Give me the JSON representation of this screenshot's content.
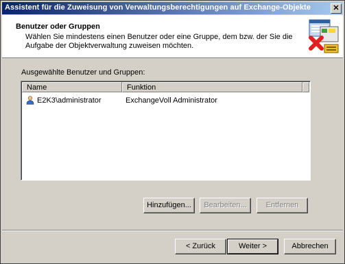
{
  "window": {
    "title": "Assistent für die Zuweisung von Verwaltungsberechtigungen auf Exchange-Objekte",
    "close_glyph": "✕"
  },
  "header": {
    "title": "Benutzer oder Gruppen",
    "description": "Wählen Sie mindestens einen Benutzer oder eine Gruppe, dem bzw. der Sie die Aufgabe der Objektverwaltung zuweisen möchten.",
    "icon": "wizard-objects-icon"
  },
  "list": {
    "label": "Ausgewählte Benutzer und Gruppen:",
    "columns": [
      "Name",
      "Funktion"
    ],
    "rows": [
      {
        "name": "E2K3\\administrator",
        "function": "ExchangeVoll Administrator",
        "icon": "user-icon"
      }
    ]
  },
  "list_buttons": {
    "add": "Hinzufügen...",
    "edit": "Bearbeiten...",
    "remove": "Entfernen"
  },
  "nav_buttons": {
    "back": "< Zurück",
    "next": "Weiter >",
    "cancel": "Abbrechen"
  },
  "colors": {
    "titlebar_start": "#0a246a",
    "titlebar_end": "#a6caf0",
    "dialog_face": "#d4d0c8"
  }
}
